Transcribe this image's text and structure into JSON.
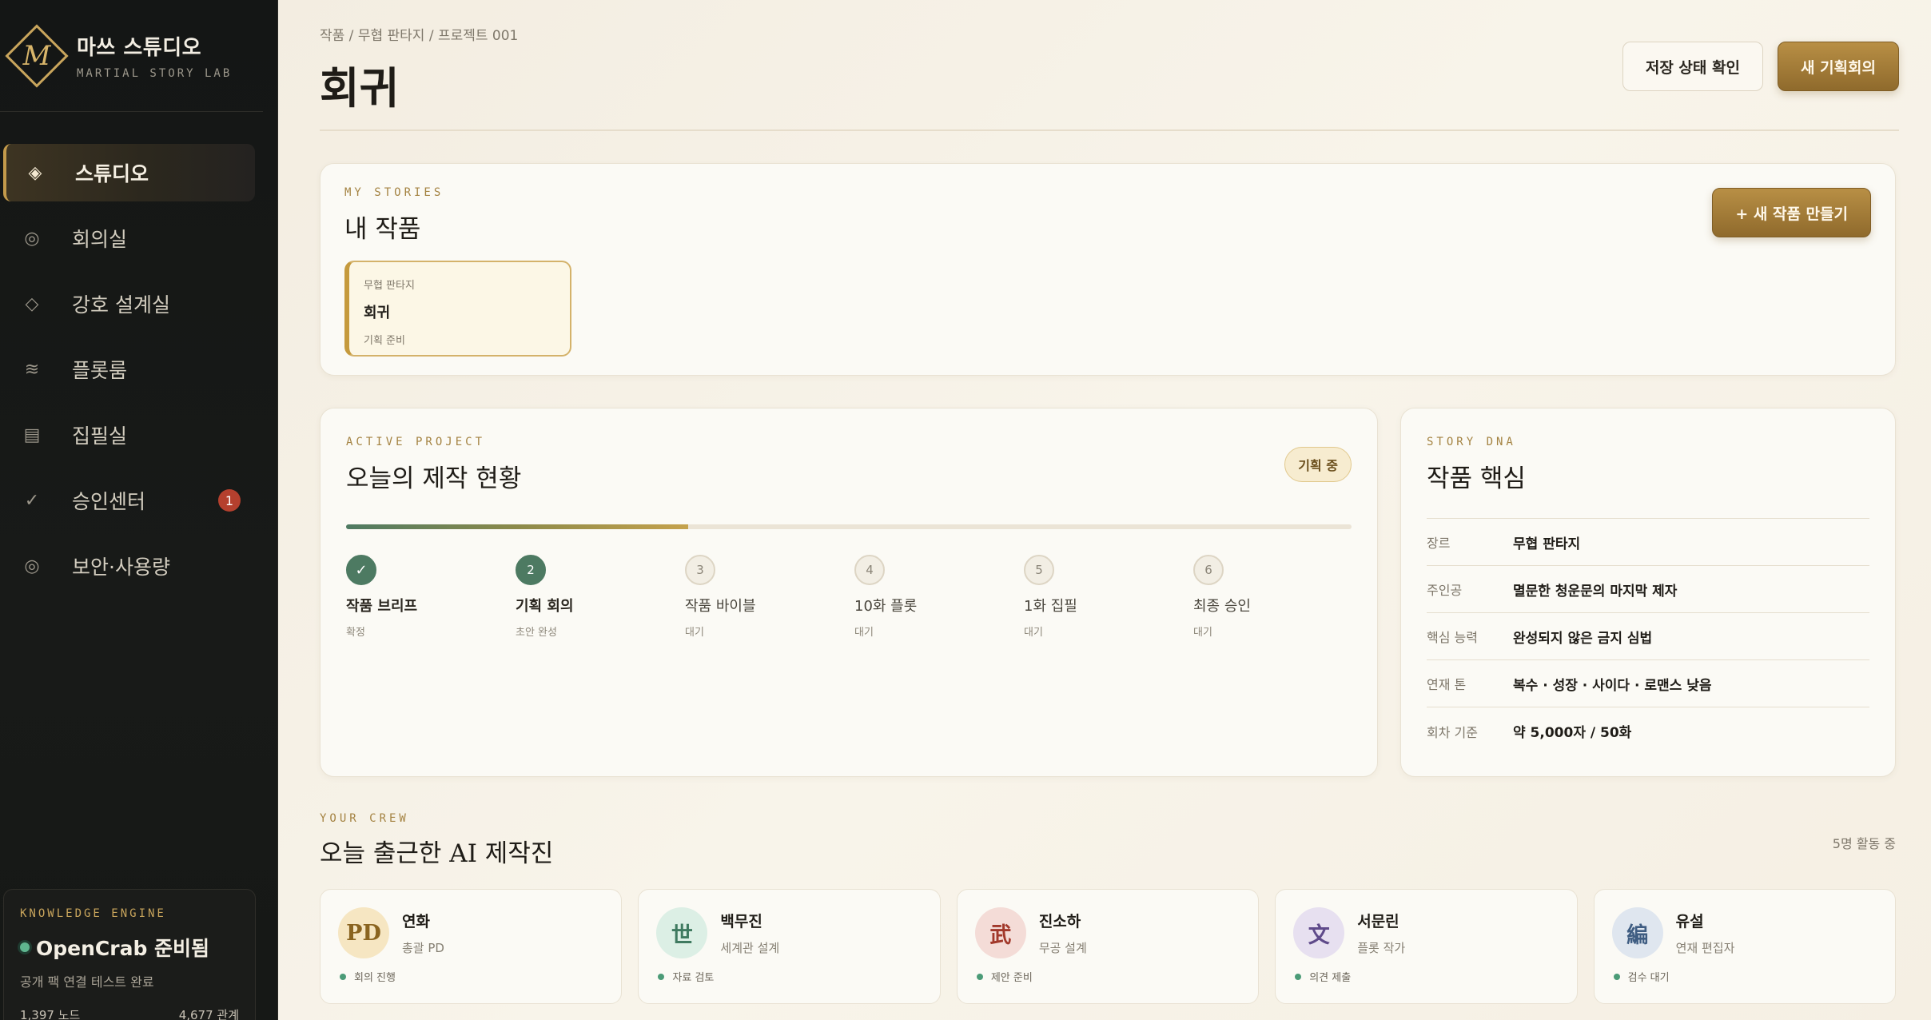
{
  "brand": {
    "name": "마쓰 스튜디오",
    "subtitle": "MARTIAL STORY LAB",
    "logo_letter": "M"
  },
  "sidebar": {
    "items": [
      {
        "label": "스튜디오",
        "icon": "diamond-filled-icon",
        "glyph": "◈",
        "active": true
      },
      {
        "label": "회의실",
        "icon": "target-ring-icon",
        "glyph": "◎"
      },
      {
        "label": "강호 설계실",
        "icon": "diamond-outline-icon",
        "glyph": "◇"
      },
      {
        "label": "플롯룸",
        "icon": "wave-icon",
        "glyph": "≋"
      },
      {
        "label": "집필실",
        "icon": "document-lines-icon",
        "glyph": "▤"
      },
      {
        "label": "승인센터",
        "icon": "check-icon",
        "glyph": "✓",
        "badge": "1"
      },
      {
        "label": "보안·사용량",
        "icon": "shield-ring-icon",
        "glyph": "◎"
      }
    ],
    "knowledge": {
      "label": "KNOWLEDGE ENGINE",
      "status": "OpenCrab 준비됨",
      "description": "공개 팩 연결 테스트 완료",
      "nodes": "1,397 노드",
      "relations": "4,677 관계"
    }
  },
  "header": {
    "breadcrumb": "작품 / 무협 판타지 / 프로젝트 001",
    "title": "회귀",
    "save_check_label": "저장 상태 확인",
    "new_meeting_label": "새 기획회의"
  },
  "stories": {
    "eyebrow": "MY STORIES",
    "title": "내 작품",
    "new_button": "+ 새 작품 만들기",
    "items": [
      {
        "genre": "무협 판타지",
        "name": "회귀",
        "status": "기획 준비"
      }
    ]
  },
  "progress": {
    "eyebrow": "ACTIVE PROJECT",
    "title": "오늘의 제작 현황",
    "phase": "기획 중",
    "percent": 34,
    "steps": [
      {
        "num": "✓",
        "label": "작품 브리프",
        "sub": "확정",
        "state": "done"
      },
      {
        "num": "2",
        "label": "기획 회의",
        "sub": "초안 완성",
        "state": "current"
      },
      {
        "num": "3",
        "label": "작품 바이블",
        "sub": "대기",
        "state": "pending"
      },
      {
        "num": "4",
        "label": "10화 플롯",
        "sub": "대기",
        "state": "pending"
      },
      {
        "num": "5",
        "label": "1화 집필",
        "sub": "대기",
        "state": "pending"
      },
      {
        "num": "6",
        "label": "최종 승인",
        "sub": "대기",
        "state": "pending"
      }
    ]
  },
  "dna": {
    "eyebrow": "STORY DNA",
    "title": "작품 핵심",
    "rows": [
      {
        "key": "장르",
        "value": "무협 판타지"
      },
      {
        "key": "주인공",
        "value": "멸문한 청운문의 마지막 제자"
      },
      {
        "key": "핵심 능력",
        "value": "완성되지 않은 금지 심법"
      },
      {
        "key": "연재 톤",
        "value": "복수 · 성장 · 사이다 · 로맨스 낮음"
      },
      {
        "key": "회차 기준",
        "value": "약 5,000자 / 50화"
      }
    ]
  },
  "crew": {
    "eyebrow": "YOUR CREW",
    "title": "오늘 출근한 AI 제작진",
    "count": "5명 활동 중",
    "members": [
      {
        "avatar": "PD",
        "name": "연화",
        "role": "총괄 PD",
        "status": "회의 진행",
        "bg": "#f6e6c2",
        "fg": "#8a6420"
      },
      {
        "avatar": "世",
        "name": "백무진",
        "role": "세계관 설계",
        "status": "자료 검토",
        "bg": "#dcefe5",
        "fg": "#3f7a60"
      },
      {
        "avatar": "武",
        "name": "진소하",
        "role": "무공 설계",
        "status": "제안 준비",
        "bg": "#f4dcd7",
        "fg": "#a2392b"
      },
      {
        "avatar": "文",
        "name": "서문린",
        "role": "플롯 작가",
        "status": "의견 제출",
        "bg": "#e7e0f0",
        "fg": "#5f4a8a"
      },
      {
        "avatar": "編",
        "name": "유설",
        "role": "연재 편집자",
        "status": "검수 대기",
        "bg": "#dfe6ef",
        "fg": "#3f5d82"
      }
    ]
  }
}
